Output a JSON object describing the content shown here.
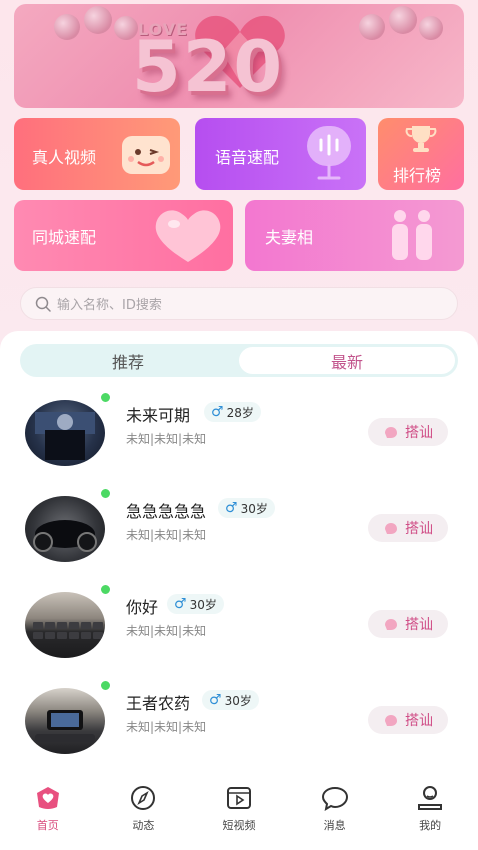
{
  "banner": {
    "love_text": "LOVE",
    "big_text": "520"
  },
  "features": {
    "video": "真人视频",
    "voice": "语音速配",
    "rank": "排行榜",
    "city": "同城速配",
    "couple": "夫妻相"
  },
  "search": {
    "placeholder": "输入名称、ID搜索"
  },
  "tabs": [
    {
      "label": "推荐"
    },
    {
      "label": "最新"
    }
  ],
  "users": [
    {
      "name": "未来可期",
      "age": "28岁",
      "location": "未知|未知|未知",
      "action": "搭讪"
    },
    {
      "name": "急急急急急",
      "age": "30岁",
      "location": "未知|未知|未知",
      "action": "搭讪"
    },
    {
      "name": "你好",
      "age": "30岁",
      "location": "未知|未知|未知",
      "action": "搭讪"
    },
    {
      "name": "王者农药",
      "age": "30岁",
      "location": "未知|未知|未知",
      "action": "搭讪"
    }
  ],
  "nav": [
    {
      "label": "首页",
      "icon": "home-heart-icon"
    },
    {
      "label": "动态",
      "icon": "compass-icon"
    },
    {
      "label": "短视频",
      "icon": "video-icon"
    },
    {
      "label": "消息",
      "icon": "chat-icon"
    },
    {
      "label": "我的",
      "icon": "profile-icon"
    }
  ],
  "colors": {
    "accent": "#d84b7d",
    "online": "#4cd964",
    "male": "#2f8fd6"
  }
}
